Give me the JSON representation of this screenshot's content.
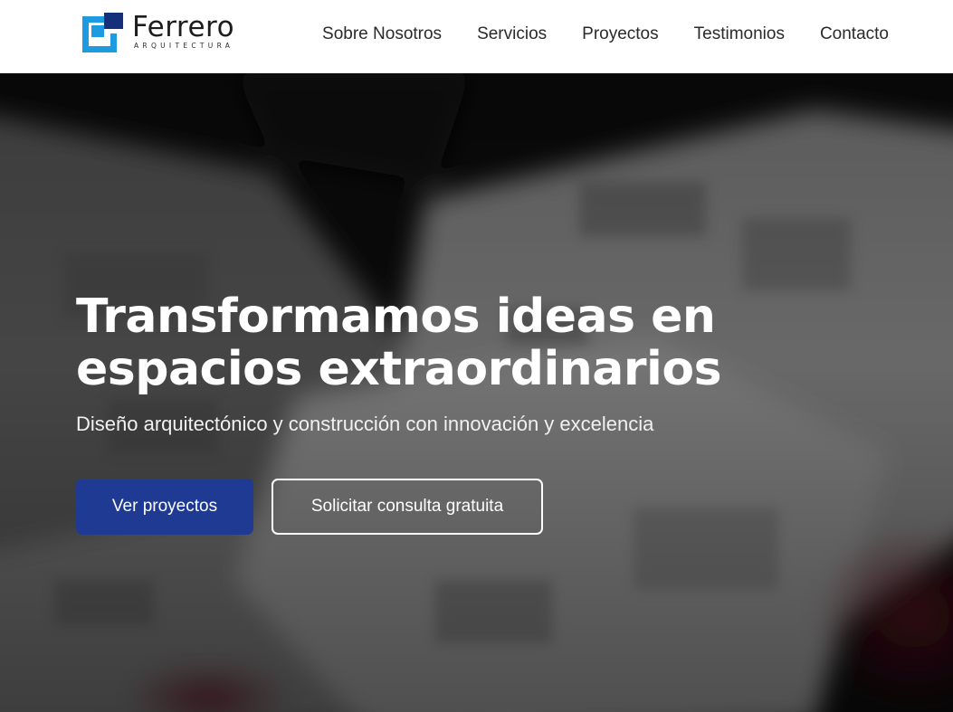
{
  "brand": {
    "name": "Ferrero",
    "tagline": "ARQUITECTURA",
    "logo_icon": "ferrero-logo-mark",
    "colors": {
      "primary_blue": "#1e3a93",
      "light_blue": "#1d9be0",
      "dark_blue": "#14307a"
    }
  },
  "nav": {
    "items": [
      {
        "label": "Sobre Nosotros"
      },
      {
        "label": "Servicios"
      },
      {
        "label": "Proyectos"
      },
      {
        "label": "Testimonios"
      },
      {
        "label": "Contacto"
      }
    ]
  },
  "hero": {
    "title": "Transformamos ideas en espacios extraordinarios",
    "subtitle": "Diseño arquitectónico y construcción con innovación y excelencia",
    "primary_button": "Ver proyectos",
    "secondary_button": "Solicitar consulta gratuita",
    "background": "blurred-architectural-blueprints"
  }
}
